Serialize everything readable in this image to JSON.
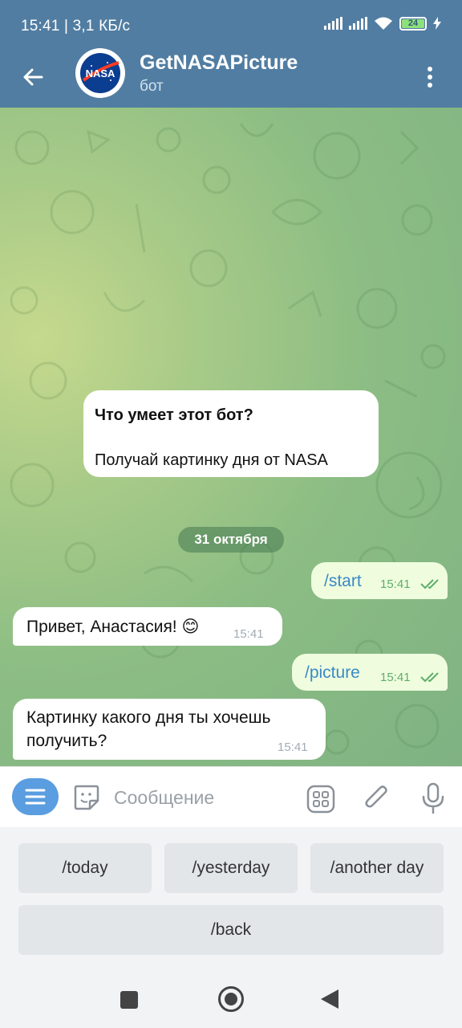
{
  "status_bar": {
    "time_speed": "15:41 | 3,1 КБ/с",
    "battery_level": "24"
  },
  "header": {
    "title": "GetNASAPicture",
    "subtitle": "бот",
    "avatar_text": "NASA"
  },
  "intro": {
    "heading": "Что умеет этот бот?",
    "body": "Получай картинку дня от NASA"
  },
  "date_chip": "31 октября",
  "messages": [
    {
      "dir": "out",
      "text": "/start",
      "time": "15:41",
      "command": true
    },
    {
      "dir": "in",
      "text": "Привет, Анастасия! 😊",
      "time": "15:41"
    },
    {
      "dir": "out",
      "text": "/picture",
      "time": "15:41",
      "command": true
    },
    {
      "dir": "in",
      "line1": "Картинку какого дня ты хочешь",
      "line2": "получить?",
      "time": "15:41"
    }
  ],
  "input": {
    "placeholder": "Сообщение"
  },
  "keyboard": {
    "today": "/today",
    "yesterday": "/yesterday",
    "another_day": "/another day",
    "back": "/back"
  },
  "colors": {
    "header": "#517da2",
    "outgoing": "#effdde",
    "command": "#3a8ac6",
    "menu_button": "#5a9de0"
  }
}
